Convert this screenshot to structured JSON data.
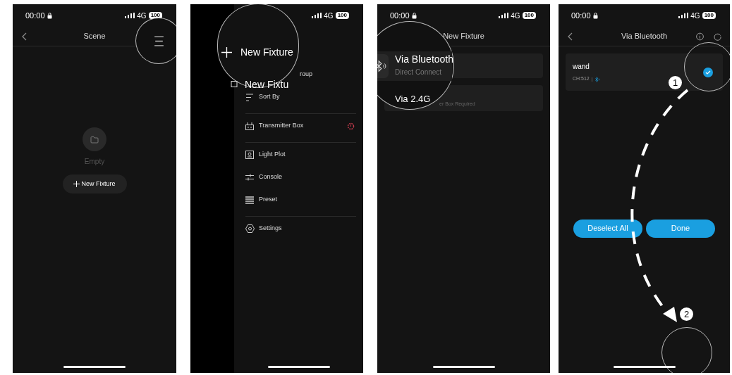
{
  "screens": [
    {
      "kind": "scene",
      "status": {
        "time": "00:00",
        "network": "4G",
        "battery": "100"
      },
      "title": "Scene",
      "empty_label": "Empty",
      "button": "New Fixture"
    },
    {
      "kind": "drawer",
      "status": {
        "network": "4G",
        "battery": "100"
      },
      "magnifier": {
        "primary": "New Fixture",
        "secondary": "New Fixtu"
      },
      "partial_label": "roup",
      "groups": [
        [
          {
            "kind": "sort",
            "label": "Sort By",
            "warning": false
          }
        ],
        [
          {
            "kind": "transmitter",
            "label": "Transmitter Box",
            "warning": true
          }
        ],
        [
          {
            "kind": "plot",
            "label": "Light Plot",
            "warning": false
          },
          {
            "kind": "console",
            "label": "Console",
            "warning": false
          },
          {
            "kind": "preset",
            "label": "Preset",
            "warning": false
          }
        ],
        [
          {
            "kind": "settings",
            "label": "Settings",
            "warning": false
          }
        ]
      ]
    },
    {
      "kind": "new-fixture",
      "status": {
        "time": "00:00",
        "network": "4G",
        "battery": "100"
      },
      "title": "New Fixture",
      "magnifier": {
        "title": "Via Bluetooth",
        "subtitle": "Direct Connect",
        "second_title": "Via 2.4G"
      },
      "partial_subtitle": "er Box Required"
    },
    {
      "kind": "device-list",
      "status": {
        "time": "00:00",
        "network": "4G",
        "battery": "100"
      },
      "title": "Via Bluetooth",
      "devices": [
        {
          "name": "wand",
          "channel": "CH:512",
          "selected": true
        }
      ],
      "buttons": [
        "Deselect All",
        "Done"
      ],
      "steps": [
        "1",
        "2"
      ]
    }
  ]
}
